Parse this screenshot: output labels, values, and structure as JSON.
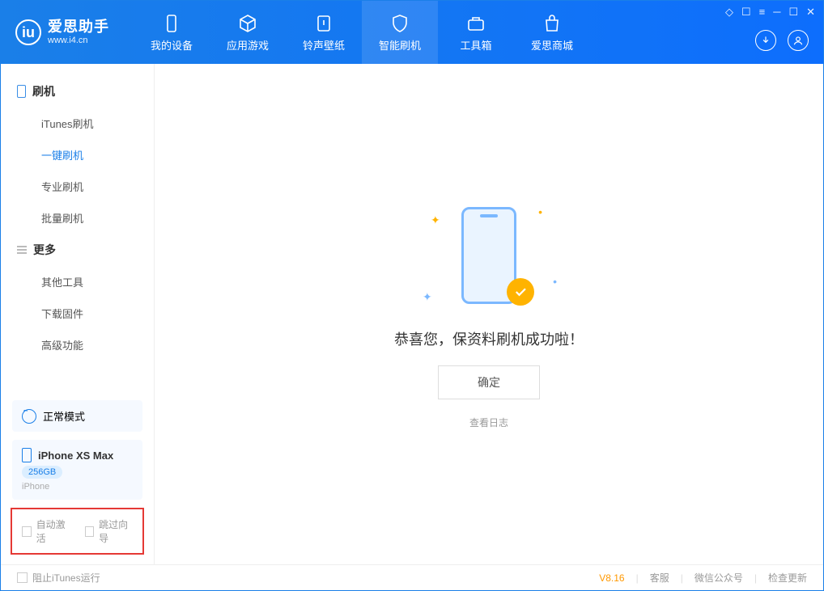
{
  "app": {
    "name": "爱思助手",
    "url": "www.i4.cn"
  },
  "tabs": [
    {
      "label": "我的设备"
    },
    {
      "label": "应用游戏"
    },
    {
      "label": "铃声壁纸"
    },
    {
      "label": "智能刷机"
    },
    {
      "label": "工具箱"
    },
    {
      "label": "爱思商城"
    }
  ],
  "sidebar": {
    "group1": {
      "title": "刷机",
      "items": [
        "iTunes刷机",
        "一键刷机",
        "专业刷机",
        "批量刷机"
      ]
    },
    "group2": {
      "title": "更多",
      "items": [
        "其他工具",
        "下载固件",
        "高级功能"
      ]
    }
  },
  "mode_label": "正常模式",
  "device": {
    "name": "iPhone XS Max",
    "storage": "256GB",
    "type": "iPhone"
  },
  "redbox": {
    "auto_activate": "自动激活",
    "skip_guide": "跳过向导"
  },
  "main": {
    "message": "恭喜您，保资料刷机成功啦！",
    "ok": "确定",
    "viewlog": "查看日志"
  },
  "footer": {
    "block_itunes": "阻止iTunes运行",
    "version": "V8.16",
    "support": "客服",
    "wechat": "微信公众号",
    "update": "检查更新"
  }
}
